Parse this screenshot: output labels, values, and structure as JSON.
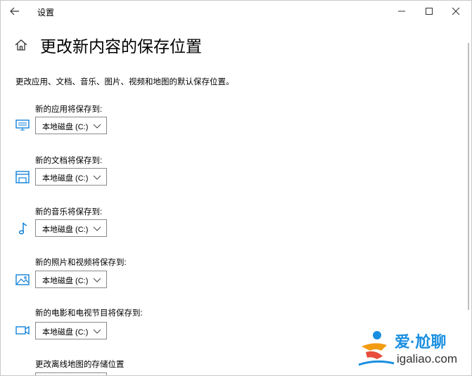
{
  "window": {
    "app_title": "设置"
  },
  "page": {
    "title": "更改新内容的保存位置",
    "description": "更改应用、文档、音乐、图片、视频和地图的默认保存位置。"
  },
  "rows": [
    {
      "label": "新的应用将保存到:",
      "icon": "monitor-icon",
      "value": "本地磁盘 (C:)"
    },
    {
      "label": "新的文档将保存到:",
      "icon": "drive-icon",
      "value": "本地磁盘 (C:)"
    },
    {
      "label": "新的音乐将保存到:",
      "icon": "music-note-icon",
      "value": "本地磁盘 (C:)"
    },
    {
      "label": "新的照片和视频将保存到:",
      "icon": "picture-icon",
      "value": "本地磁盘 (C:)"
    },
    {
      "label": "新的电影和电视节目将保存到:",
      "icon": "video-camera-icon",
      "value": "本地磁盘 (C:)"
    }
  ],
  "offline_maps": {
    "label": "更改离线地图的存储位置"
  },
  "watermark": {
    "text_cn": "爱·尬聊",
    "text_en": "igaliao.com"
  },
  "colors": {
    "accent": "#0078d7",
    "border": "#8a8a8a",
    "watermark_blue": "#1a8fe0",
    "watermark_orange": "#f39c12"
  }
}
